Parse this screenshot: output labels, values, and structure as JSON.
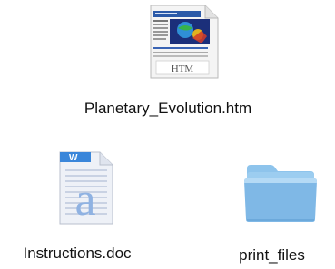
{
  "files": [
    {
      "name": "Planetary_Evolution.htm",
      "type": "htm",
      "icon": "html-document-icon",
      "badge": "HTM"
    },
    {
      "name": "Instructions.doc",
      "type": "doc",
      "icon": "word-document-icon",
      "badge": "W",
      "glyph": "a"
    },
    {
      "name": "print_files",
      "type": "folder",
      "icon": "folder-icon"
    }
  ],
  "colors": {
    "folder_top": "#a9d3f2",
    "folder_body": "#7fb8e6",
    "word_blue": "#2a6fc7",
    "text": "#111111"
  }
}
